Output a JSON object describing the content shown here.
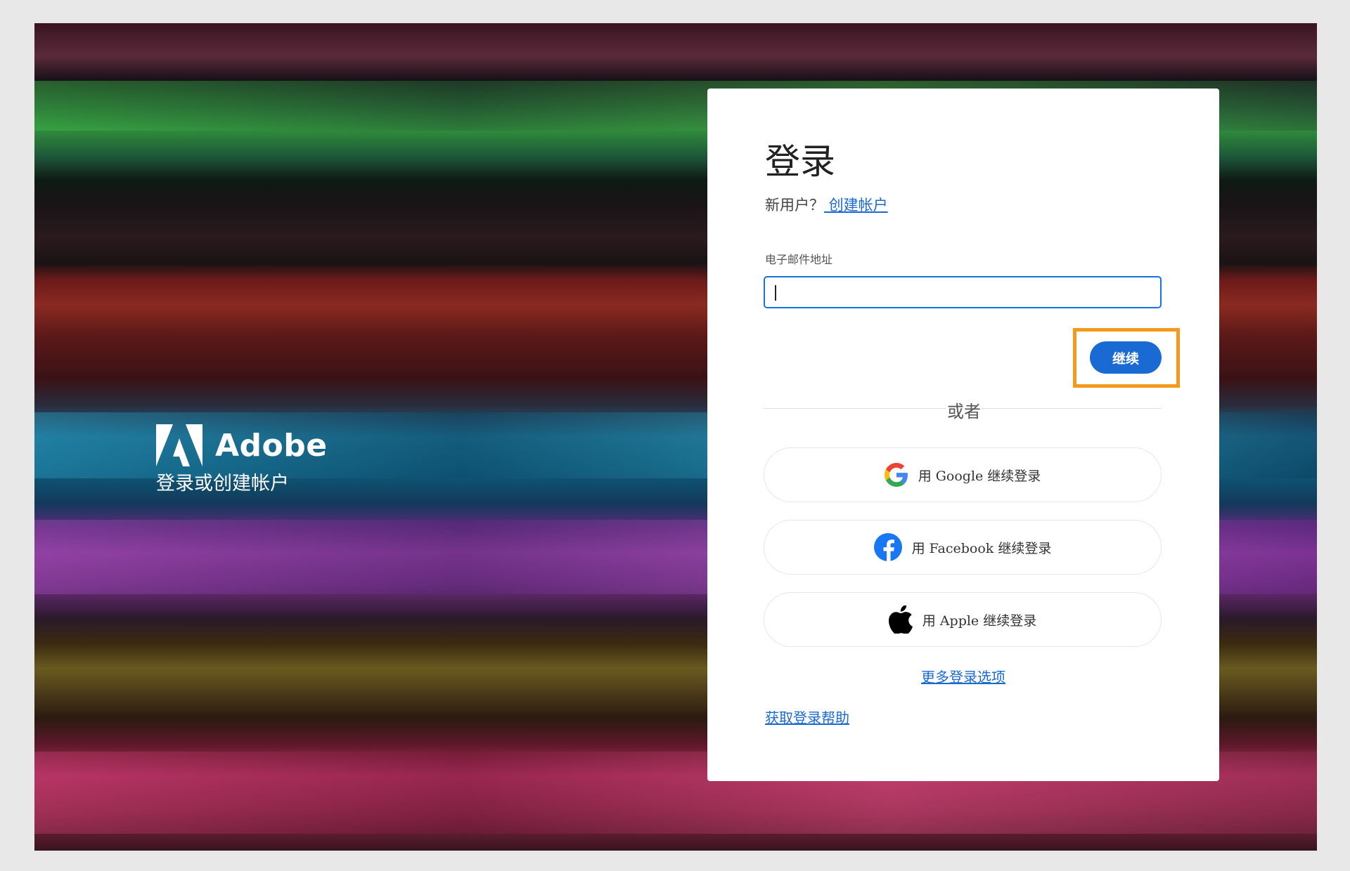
{
  "brand": {
    "name": "Adobe",
    "tagline": "登录或创建帐户"
  },
  "login": {
    "title": "登录",
    "new_user_prompt": "新用户？",
    "create_account_link": " 创建帐户",
    "email_label": "电子邮件地址",
    "email_value": "",
    "continue_label": "继续",
    "or_label": "或者",
    "google_label": "用 Google 继续登录",
    "facebook_label": "用 Facebook 继续登录",
    "apple_label": "用 Apple 继续登录",
    "more_options_link": "更多登录选项",
    "help_link": "获取登录帮助"
  },
  "colors": {
    "accent": "#1a6ad4",
    "highlight": "#f39a1e"
  },
  "icons": {
    "brand": "adobe-logo-icon",
    "google": "google-icon",
    "facebook": "facebook-icon",
    "apple": "apple-icon"
  }
}
